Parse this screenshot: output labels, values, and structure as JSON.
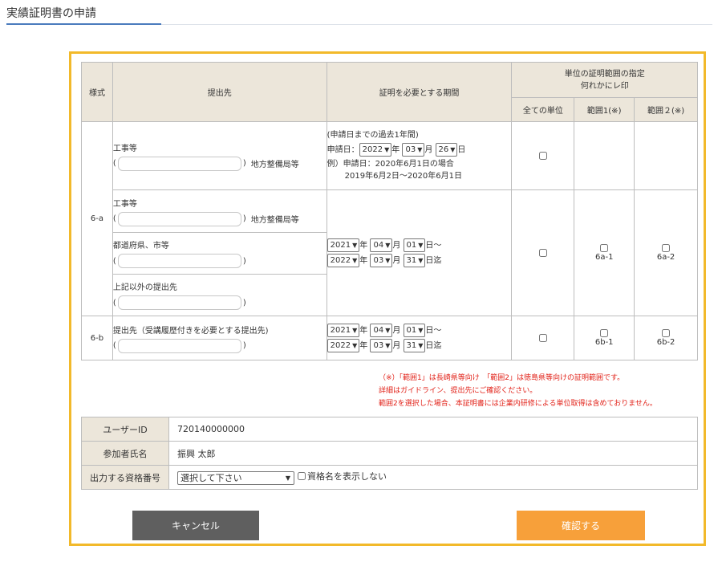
{
  "page": {
    "title": "実績証明書の申請"
  },
  "table": {
    "headers": {
      "format": "様式",
      "destination": "提出先",
      "period": "証明を必要とする期間",
      "range_title_1": "単位の証明範囲の指定",
      "range_title_2": "何れかにレ印",
      "all_units": "全ての単位",
      "range1": "範囲1(※)",
      "range2": "範囲２(※)"
    },
    "row1": {
      "dest_label": "工事等",
      "paren_open": "(",
      "paren_close": ")",
      "suffix": "地方整備局等",
      "period_line1": "(申請日までの過去1年間)",
      "date_prefix": "申請日：",
      "year": "2022",
      "month": "03",
      "day": "26",
      "unit_year": "年",
      "unit_month": "月",
      "unit_day": "日",
      "example_line1": "例）申請日：2020年6月1日の場合",
      "example_line2": "2019年6月2日～2020年6月1日"
    },
    "format_6a": "6-a",
    "row2": {
      "dest_label": "工事等",
      "suffix": "地方整備局等",
      "dest2_label": "都道府県、市等",
      "dest3_label": "上記以外の提出先",
      "from": {
        "year": "2021",
        "month": "04",
        "day": "01",
        "tail": "日～"
      },
      "to": {
        "year": "2022",
        "month": "03",
        "day": "31",
        "tail": "日迄"
      },
      "range1_label": "6a-1",
      "range2_label": "6a-2"
    },
    "format_6b": "6-b",
    "row3": {
      "dest_label": "提出先（受講履歴付きを必要とする提出先)",
      "from": {
        "year": "2021",
        "month": "04",
        "day": "01",
        "tail": "日～"
      },
      "to": {
        "year": "2022",
        "month": "03",
        "day": "31",
        "tail": "日迄"
      },
      "range1_label": "6b-1",
      "range2_label": "6b-2"
    }
  },
  "note": {
    "line1": "（※）「範囲1」は長崎県等向け　「範囲2」は徳島県等向けの証明範囲です。",
    "line2": "詳細はガイドライン、提出先にご確認ください。",
    "line3": "範囲2を選択した場合、本証明書には企業内研修による単位取得は含めておりません。"
  },
  "user": {
    "id_label": "ユーザーID",
    "id_value": "720140000000",
    "name_label": "参加者氏名",
    "name_value": "振興 太郎",
    "cert_label": "出力する資格番号",
    "cert_select": "選択して下さい",
    "hide_name_label": "資格名を表示しない"
  },
  "buttons": {
    "cancel": "キャンセル",
    "confirm": "確認する"
  },
  "colors": {
    "frame": "#f2b92a",
    "header_bg": "#ece6da",
    "cancel": "#5f5f5f",
    "confirm": "#f7a03a",
    "note": "#e2231a"
  }
}
